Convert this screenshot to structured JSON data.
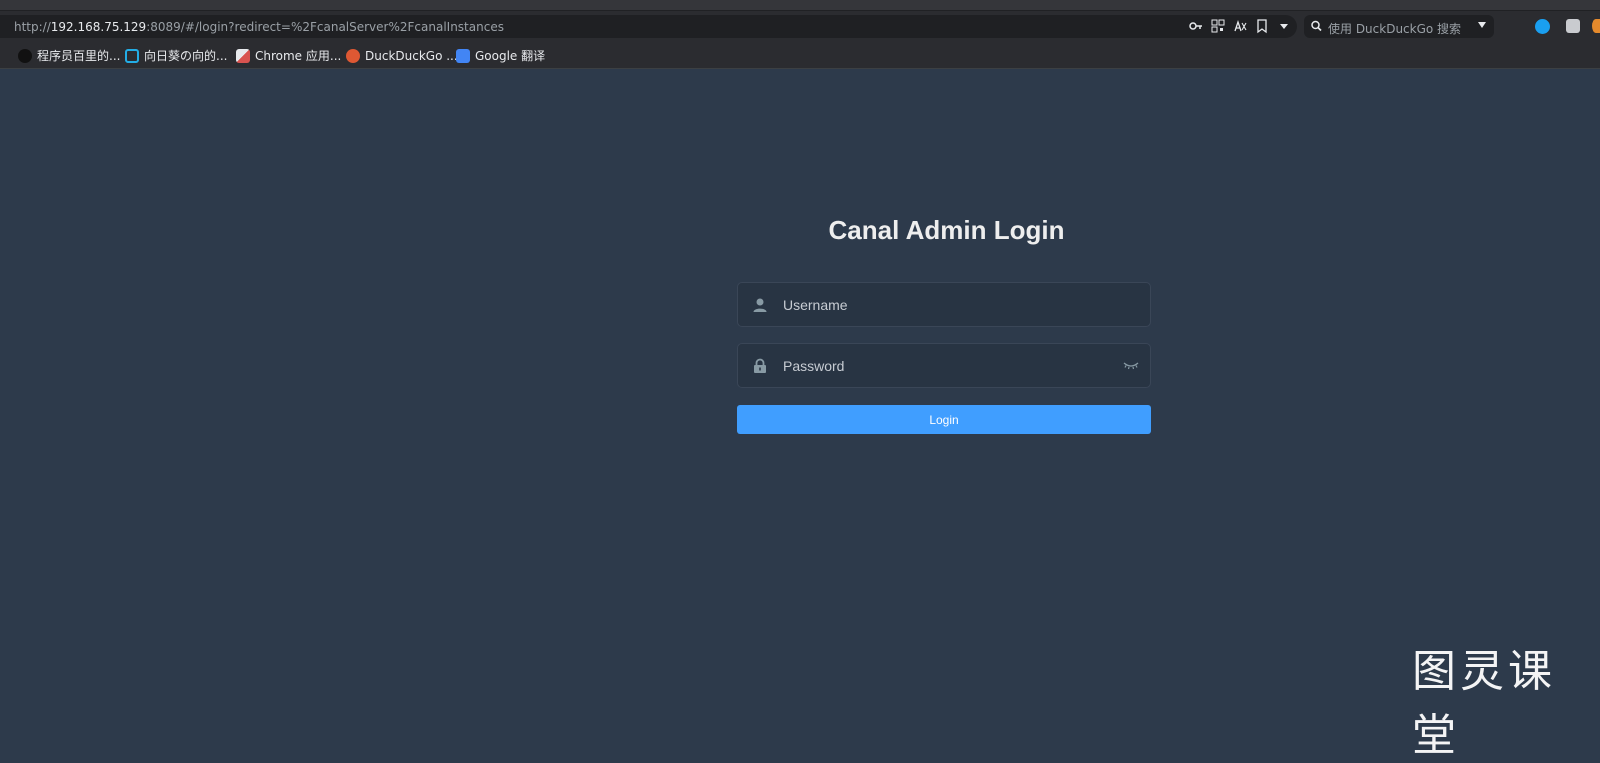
{
  "browser": {
    "url_prefix": "http://",
    "url_host": "192.168.75.129",
    "url_rest": ":8089/#/login?redirect=%2FcanalServer%2FcanalInstances",
    "search_placeholder": "使用 DuckDuckGo 搜索",
    "toolbar_icons": [
      "key-icon",
      "qr-code-icon",
      "translate-icon",
      "bookmark-icon",
      "dropdown-icon"
    ],
    "bookmarks": [
      {
        "label": "程序员百里的...",
        "icon": "tiktok-icon",
        "color": "#111111"
      },
      {
        "label": "向日葵の向的...",
        "icon": "bilibili-icon",
        "color": "#23ade5"
      },
      {
        "label": "Chrome 应用...",
        "icon": "chrome-apps-icon",
        "color": "#d9534f"
      },
      {
        "label": "DuckDuckGo ...",
        "icon": "duckduckgo-icon",
        "color": "#de5833"
      },
      {
        "label": "Google 翻译",
        "icon": "google-translate-icon",
        "color": "#4285f4"
      }
    ]
  },
  "login": {
    "title": "Canal Admin Login",
    "username_placeholder": "Username",
    "password_placeholder": "Password",
    "button_label": "Login"
  },
  "watermark": "图灵课堂",
  "colors": {
    "page_bg": "#2d3a4b",
    "input_bg": "#283443",
    "button_bg": "#409eff"
  }
}
